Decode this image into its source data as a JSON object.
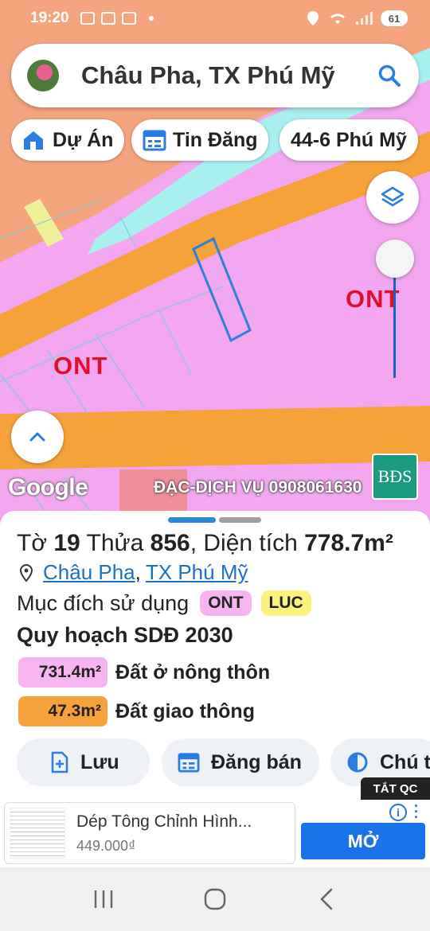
{
  "status_bar": {
    "time": "19:20",
    "battery": "61"
  },
  "search": {
    "title": "Châu Pha, TX Phú Mỹ"
  },
  "chips": [
    {
      "label": "Dự Án",
      "icon": "home-icon"
    },
    {
      "label": "Tin Đăng",
      "icon": "calendar-icon"
    },
    {
      "label": "44-6 Phú Mỹ",
      "icon": ""
    }
  ],
  "map": {
    "labels": [
      "ONT",
      "ONT"
    ],
    "google": "Google",
    "watermark": "ĐẠC-DỊCH VỤ 0908061630",
    "brand_logo": "BĐS",
    "colors": {
      "residential": "#f2a7f0",
      "road": "#f5a23a",
      "water": "#a8f0f0",
      "agri": "#f0f09a",
      "parcel_outline": "#2e7fd6"
    }
  },
  "parcel": {
    "prefix_sheet": "Tờ",
    "sheet": "19",
    "prefix_plot": "Thửa",
    "plot": "856",
    "prefix_area": ", Diện tích",
    "area": "778.7m²",
    "commune": "Châu Pha",
    "town": "TX Phú Mỹ",
    "separator": ",",
    "purpose_label": "Mục đích sử dụng",
    "purposes": [
      "ONT",
      "LUC"
    ]
  },
  "plan": {
    "title": "Quy hoạch SDĐ 2030",
    "rows": [
      {
        "area": "731.4m²",
        "name": "Đất ở nông thôn",
        "color": "#f7b4f0"
      },
      {
        "area": "47.3m²",
        "name": "Đất giao thông",
        "color": "#f5a23a"
      }
    ]
  },
  "actions": [
    {
      "label": "Lưu",
      "icon": "add-file-icon"
    },
    {
      "label": "Đăng bán",
      "icon": "calendar-icon"
    },
    {
      "label": "Chú t",
      "icon": "contrast-icon"
    }
  ],
  "ad": {
    "close_label": "TẮT QC",
    "title": "Dép Tông Chỉnh Hình...",
    "price": "449.000₫",
    "open_label": "MỞ",
    "info": "i"
  }
}
